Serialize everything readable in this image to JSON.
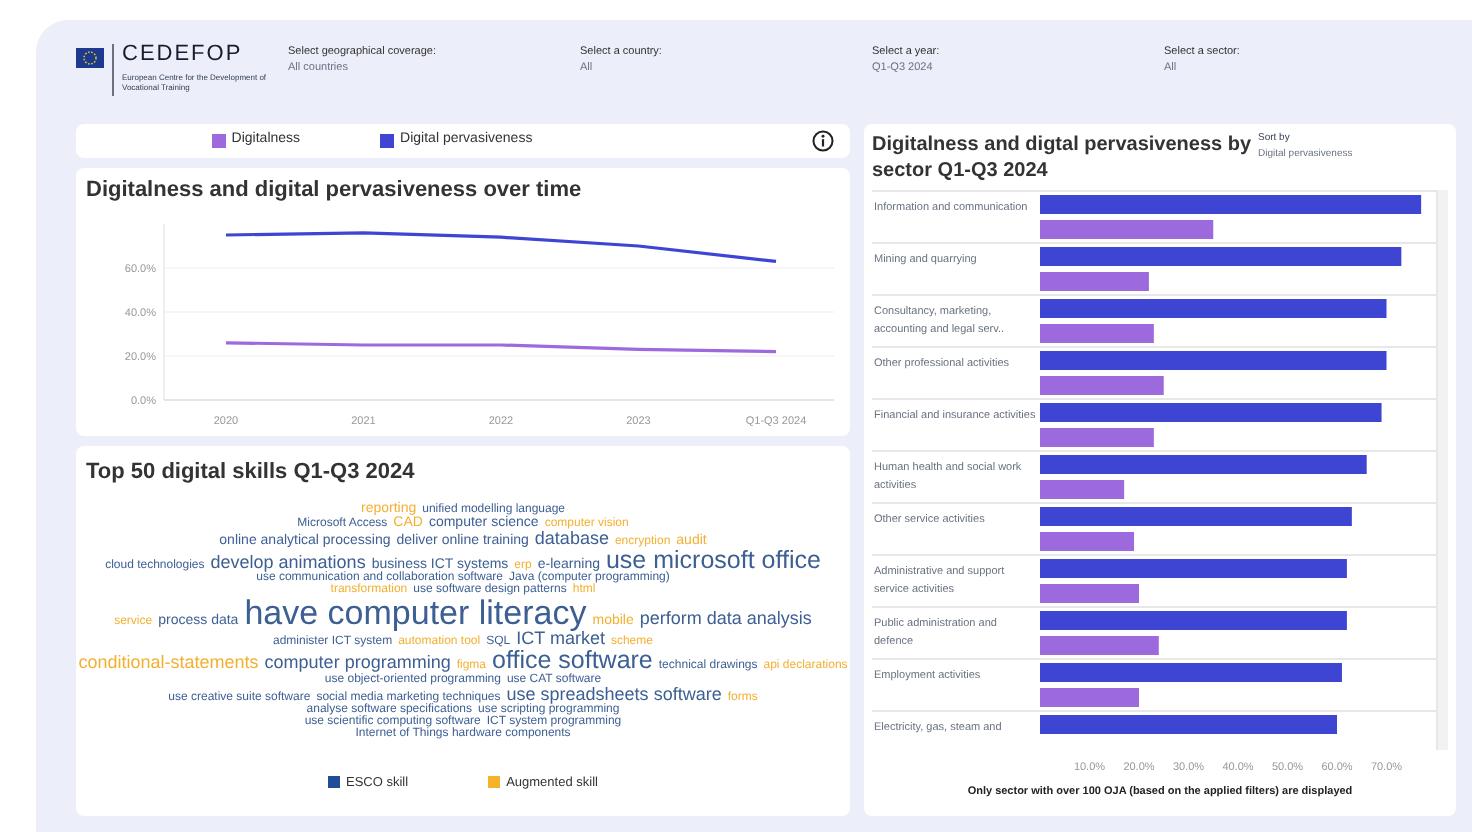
{
  "header": {
    "logo_text": "CEDEFOP",
    "logo_subtitle": "European Centre for the Development of Vocational Training",
    "filters": [
      {
        "label": "Select geographical coverage:",
        "value": "All countries"
      },
      {
        "label": "Select a country:",
        "value": "All"
      },
      {
        "label": "Select a year:",
        "value": "Q1-Q3 2024"
      },
      {
        "label": "Select a sector:",
        "value": "All"
      }
    ]
  },
  "trend_panel": {
    "title": "Digitalness and digital pervasiveness over time",
    "chart_data": {
      "type": "line",
      "categories": [
        "2020",
        "2021",
        "2022",
        "2023",
        "Q1-Q3 2024"
      ],
      "series": [
        {
          "name": "Digitalness",
          "color": "#9d6ade",
          "values": [
            26,
            25,
            25,
            23,
            22
          ]
        },
        {
          "name": "Digital pervasiveness",
          "color": "#3f45d3",
          "values": [
            75,
            76,
            74,
            70,
            63
          ]
        }
      ],
      "grid": true,
      "ylim": [
        0,
        80
      ],
      "yticks": [
        {
          "value": 0,
          "label": "0.0%"
        },
        {
          "value": 20,
          "label": "20.0%"
        },
        {
          "value": 40,
          "label": "40.0%"
        },
        {
          "value": 60,
          "label": "60.0%"
        }
      ]
    }
  },
  "skills_panel": {
    "title": "Top 50 digital skills Q1-Q3 2024",
    "lines": [
      {
        "words": [
          {
            "text": "reporting",
            "color": "#f3b030",
            "kind": "small"
          },
          {
            "text": "unified modelling language",
            "color": "#3d5f93",
            "kind": "tiny"
          }
        ]
      },
      {
        "words": [
          {
            "text": "Microsoft Access",
            "color": "#3d5f93",
            "kind": "tiny"
          },
          {
            "text": "CAD",
            "color": "#f3b030",
            "kind": "small"
          },
          {
            "text": "computer science",
            "color": "#3d5f93",
            "kind": "small"
          },
          {
            "text": "computer vision",
            "color": "#f3b030",
            "kind": "tiny"
          }
        ]
      },
      {
        "words": [
          {
            "text": "online analytical processing",
            "color": "#3d5f93",
            "kind": "small"
          },
          {
            "text": "deliver online training",
            "color": "#3d5f93",
            "kind": "small"
          },
          {
            "text": "database",
            "color": "#3d5f93",
            "kind": "medium"
          },
          {
            "text": "encryption",
            "color": "#f3b030",
            "kind": "tiny"
          },
          {
            "text": "audit",
            "color": "#f3b030",
            "kind": "small"
          }
        ]
      },
      {
        "words": [
          {
            "text": "cloud technologies",
            "color": "#3d5f93",
            "kind": "tiny"
          },
          {
            "text": "develop animations",
            "color": "#3d5f93",
            "kind": "medium"
          },
          {
            "text": "business ICT systems",
            "color": "#3d5f93",
            "kind": "small"
          },
          {
            "text": "erp",
            "color": "#f3b030",
            "kind": "tiny"
          },
          {
            "text": "e-learning",
            "color": "#3d5f93",
            "kind": "small"
          },
          {
            "text": "use microsoft office",
            "color": "#3d5f93",
            "kind": "large"
          }
        ]
      },
      {
        "words": [
          {
            "text": "use communication and collaboration software",
            "color": "#3d5f93",
            "kind": "tiny"
          },
          {
            "text": "Java (computer programming)",
            "color": "#3d5f93",
            "kind": "tiny"
          }
        ]
      },
      {
        "words": [
          {
            "text": "transformation",
            "color": "#f3b030",
            "kind": "tiny"
          },
          {
            "text": "use software design patterns",
            "color": "#3d5f93",
            "kind": "tiny"
          },
          {
            "text": "html",
            "color": "#f3b030",
            "kind": "tiny"
          }
        ]
      },
      {
        "words": [
          {
            "text": "service",
            "color": "#f3b030",
            "kind": "tiny"
          },
          {
            "text": "process data",
            "color": "#3d5f93",
            "kind": "small"
          },
          {
            "text": "have computer literacy",
            "color": "#3d5f93",
            "kind": "huge"
          },
          {
            "text": "mobile",
            "color": "#f3b030",
            "kind": "small"
          },
          {
            "text": "perform data analysis",
            "color": "#3d5f93",
            "kind": "medium"
          }
        ]
      },
      {
        "words": [
          {
            "text": "administer ICT system",
            "color": "#3d5f93",
            "kind": "tiny"
          },
          {
            "text": "automation tool",
            "color": "#f3b030",
            "kind": "tiny"
          },
          {
            "text": "SQL",
            "color": "#3d5f93",
            "kind": "tiny"
          },
          {
            "text": "ICT market",
            "color": "#3d5f93",
            "kind": "medium"
          },
          {
            "text": "scheme",
            "color": "#f3b030",
            "kind": "tiny"
          }
        ]
      },
      {
        "words": [
          {
            "text": "conditional-statements",
            "color": "#f3b030",
            "kind": "medium"
          },
          {
            "text": "computer programming",
            "color": "#3d5f93",
            "kind": "medium"
          },
          {
            "text": "figma",
            "color": "#f3b030",
            "kind": "tiny"
          },
          {
            "text": "office software",
            "color": "#3d5f93",
            "kind": "large"
          },
          {
            "text": "technical drawings",
            "color": "#3d5f93",
            "kind": "tiny"
          },
          {
            "text": "api declarations",
            "color": "#f3b030",
            "kind": "tiny"
          }
        ]
      },
      {
        "words": [
          {
            "text": "use object-oriented programming",
            "color": "#3d5f93",
            "kind": "tiny"
          },
          {
            "text": "use CAT software",
            "color": "#3d5f93",
            "kind": "tiny"
          }
        ]
      },
      {
        "words": [
          {
            "text": "use creative suite software",
            "color": "#3d5f93",
            "kind": "tiny"
          },
          {
            "text": "social media marketing techniques",
            "color": "#3d5f93",
            "kind": "tiny"
          },
          {
            "text": "use spreadsheets software",
            "color": "#3d5f93",
            "kind": "medium"
          },
          {
            "text": "forms",
            "color": "#f3b030",
            "kind": "tiny"
          }
        ]
      },
      {
        "words": [
          {
            "text": "analyse software specifications",
            "color": "#3d5f93",
            "kind": "tiny"
          },
          {
            "text": "use scripting programming",
            "color": "#3d5f93",
            "kind": "tiny"
          }
        ]
      },
      {
        "words": [
          {
            "text": "use scientific computing software",
            "color": "#3d5f93",
            "kind": "tiny"
          },
          {
            "text": "ICT system programming",
            "color": "#3d5f93",
            "kind": "tiny"
          }
        ]
      },
      {
        "words": [
          {
            "text": "Internet of Things hardware components",
            "color": "#3d5f93",
            "kind": "tiny"
          }
        ]
      }
    ],
    "legend": [
      {
        "label": "ESCO skill",
        "color": "#1f4e96"
      },
      {
        "label": "Augmented skill",
        "color": "#f5b32a"
      }
    ]
  },
  "sector_panel": {
    "title": "Digitalness and digtal pervasiveness by sector Q1-Q3 2024",
    "sort_label": "Sort by",
    "sort_value": "Digital pervasiveness",
    "chart_data": {
      "type": "bar",
      "orientation": "horizontal",
      "categories": [
        "Information and communication",
        "Mining and quarrying",
        "Consultancy, marketing, accounting and legal serv..",
        "Other professional activities",
        "Financial and insurance activities",
        "Human health and social work activities",
        "Other service activities",
        "Administrative and support service activities",
        "Public administration and defence",
        "Employment activities",
        "Electricity, gas, steam and"
      ],
      "series": [
        {
          "color": "#3f45d3",
          "values": [
            77,
            73,
            70,
            70,
            69,
            66,
            63,
            62,
            62,
            61,
            60
          ]
        },
        {
          "color": "#9d6ade",
          "values": [
            35,
            22,
            23,
            25,
            23,
            17,
            19,
            20,
            24,
            20,
            null
          ]
        }
      ],
      "xlim": [
        0,
        80
      ],
      "xticks": [
        {
          "value": 10,
          "label": "10.0%"
        },
        {
          "value": 20,
          "label": "20.0%"
        },
        {
          "value": 30,
          "label": "30.0%"
        },
        {
          "value": 40,
          "label": "40.0%"
        },
        {
          "value": 50,
          "label": "50.0%"
        },
        {
          "value": 60,
          "label": "60.0%"
        },
        {
          "value": 70,
          "label": "70.0%"
        }
      ]
    },
    "footnote": "Only sector with over 100 OJA (based on the applied filters) are displayed"
  }
}
